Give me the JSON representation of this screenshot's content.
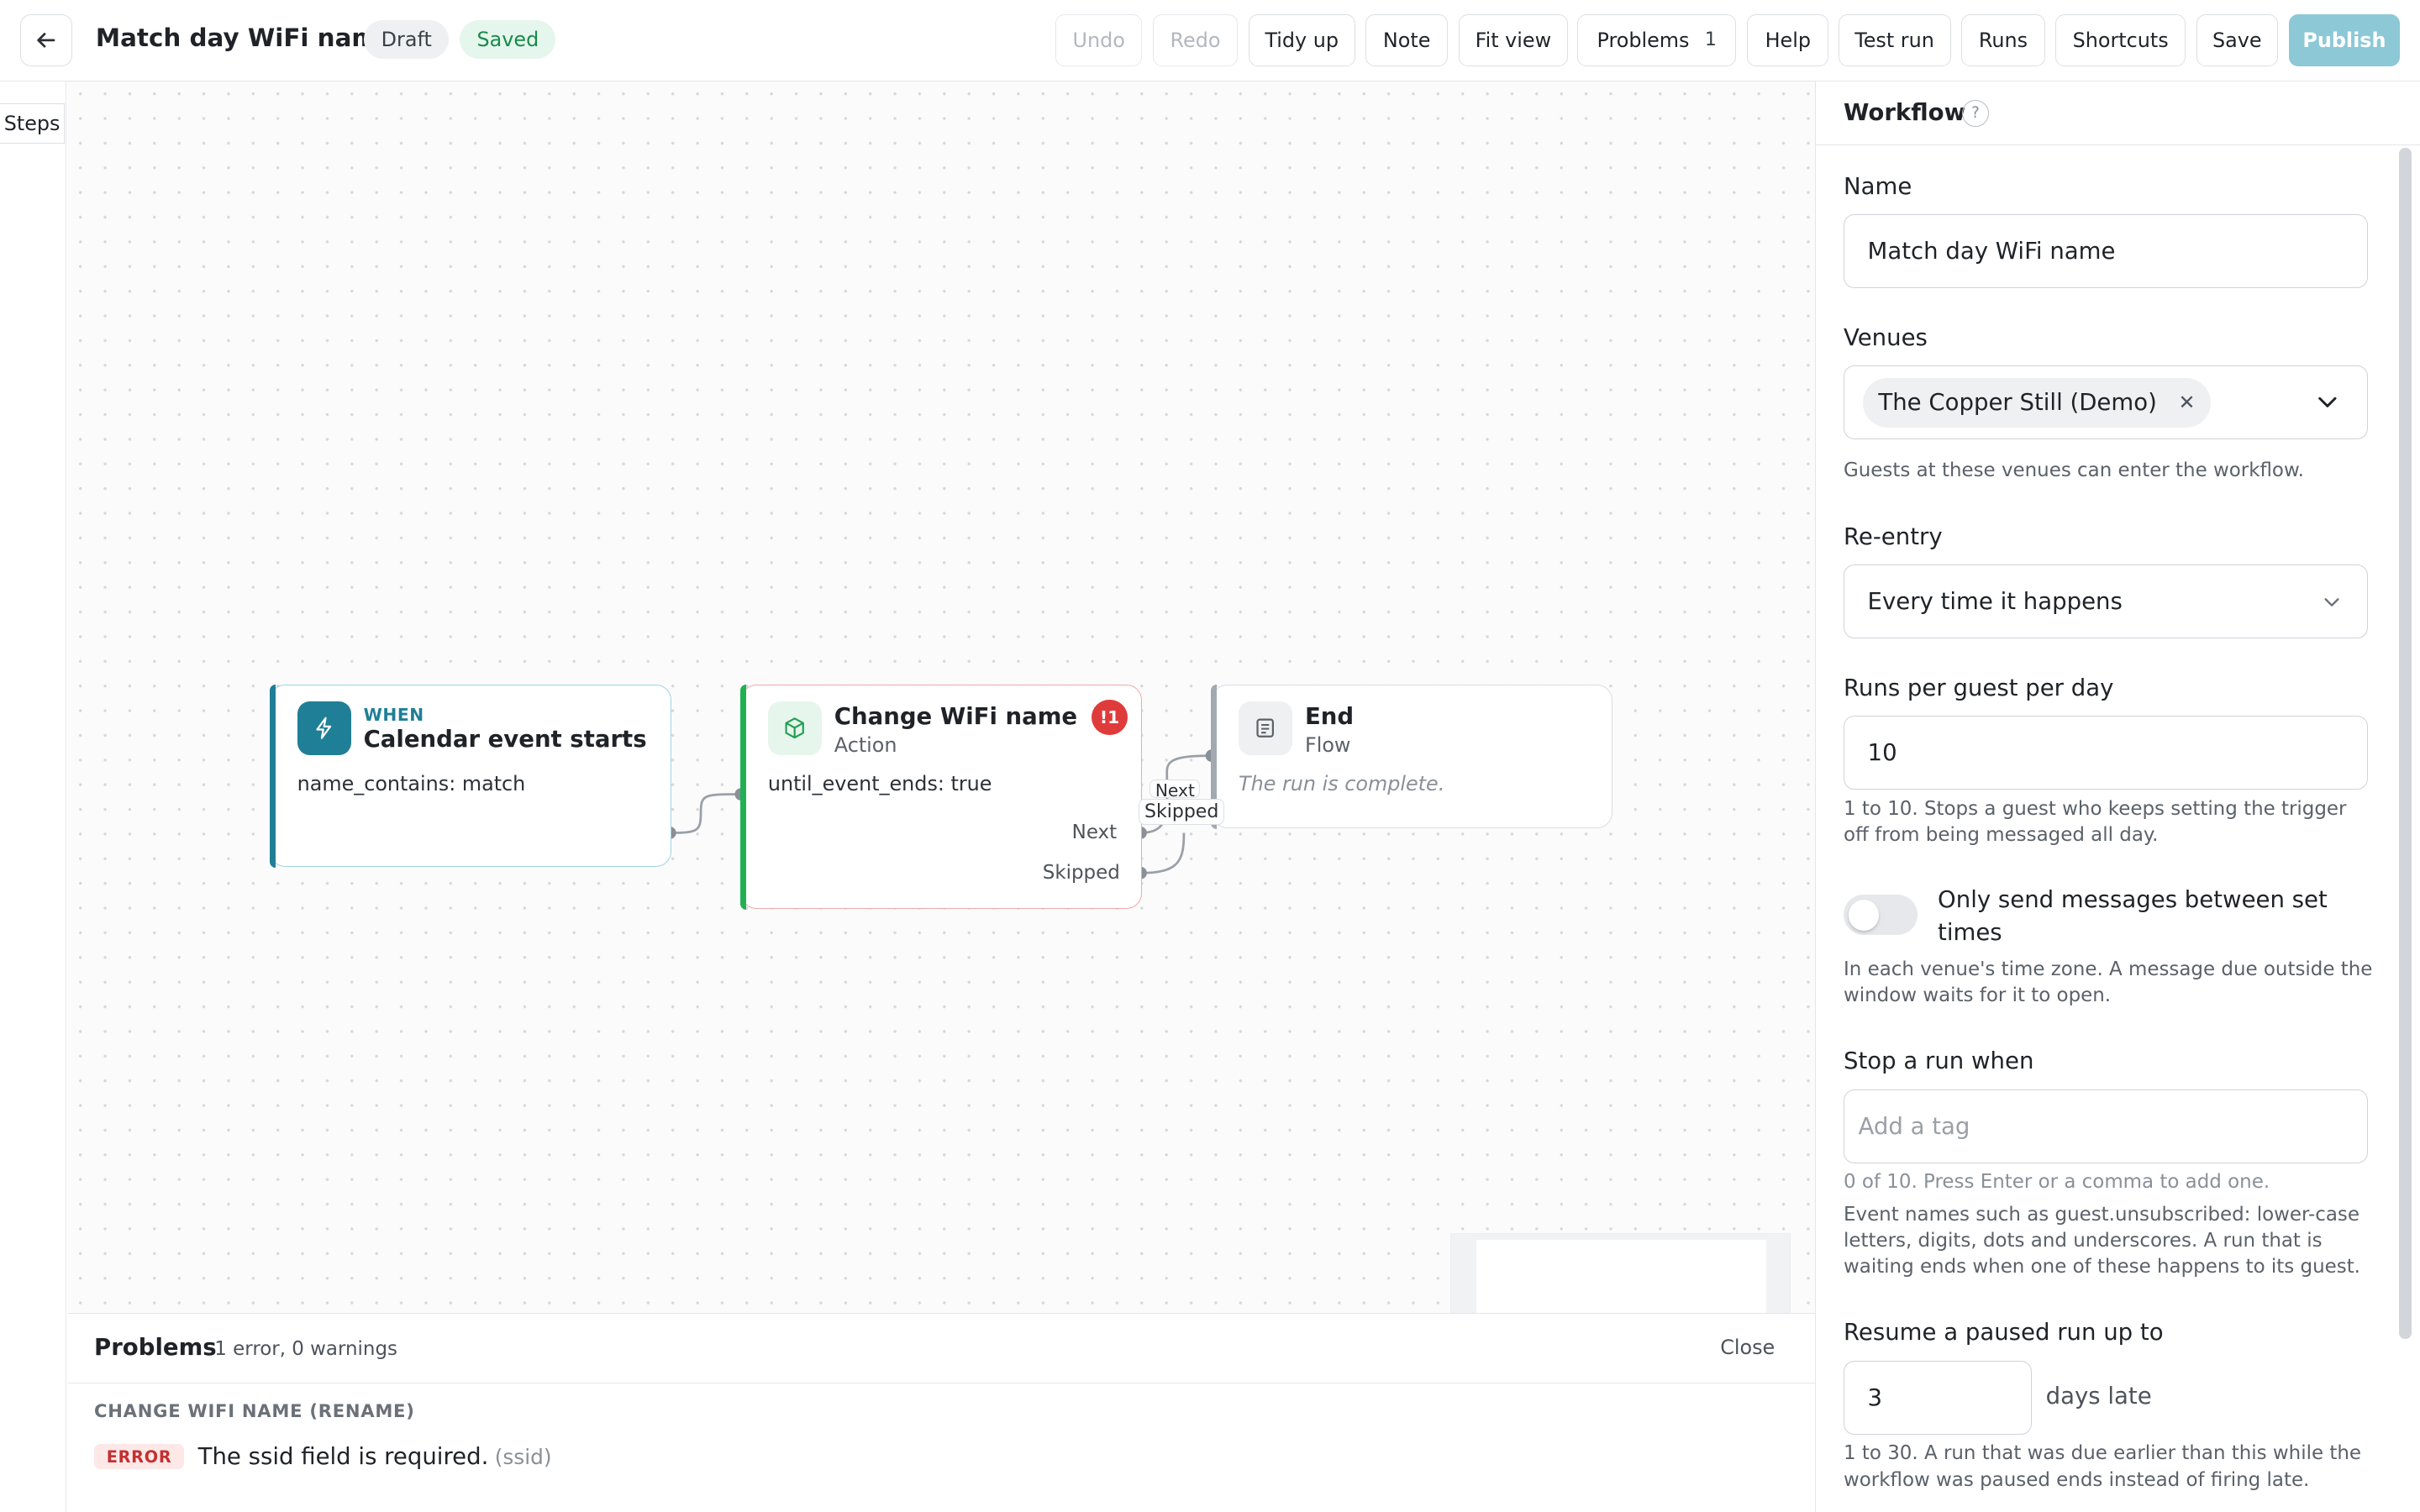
{
  "header": {
    "title": "Match day WiFi name",
    "status_draft": "Draft",
    "status_saved": "Saved",
    "buttons": {
      "undo": "Undo",
      "redo": "Redo",
      "tidy_up": "Tidy up",
      "note": "Note",
      "fit_view": "Fit view",
      "problems": "Problems",
      "problems_count": "1",
      "help": "Help",
      "test_run": "Test run",
      "runs": "Runs",
      "shortcuts": "Shortcuts",
      "save": "Save",
      "publish": "Publish"
    }
  },
  "sidebar": {
    "steps_tab": "Steps"
  },
  "canvas": {
    "nodes": {
      "trigger": {
        "kicker": "WHEN",
        "title": "Calendar event starts",
        "body": "name_contains: match"
      },
      "action": {
        "title": "Change WiFi name",
        "subtitle": "Action",
        "body": "until_event_ends: true",
        "error_badge": "!1",
        "port_next": "Next",
        "port_skipped": "Skipped"
      },
      "end": {
        "title": "End",
        "subtitle": "Flow",
        "body": "The run is complete."
      }
    },
    "edge_labels": {
      "next": "Next",
      "skipped": "Skipped"
    }
  },
  "problems_panel": {
    "title": "Problems",
    "summary": "1 error, 0 warnings",
    "close": "Close",
    "group": "CHANGE WIFI NAME (RENAME)",
    "items": [
      {
        "severity": "ERROR",
        "message": "The ssid field is required.",
        "field": "(ssid)"
      }
    ]
  },
  "inspector": {
    "title": "Workflow",
    "help_icon": "?",
    "name": {
      "label": "Name",
      "value": "Match day WiFi name"
    },
    "venues": {
      "label": "Venues",
      "chip": "The Copper Still (Demo)",
      "help": "Guests at these venues can enter the workflow."
    },
    "reentry": {
      "label": "Re-entry",
      "value": "Every time it happens"
    },
    "runs_per_day": {
      "label": "Runs per guest per day",
      "value": "10",
      "help": "1 to 10. Stops a guest who keeps setting the trigger off from being messaged all day."
    },
    "send_window": {
      "label": "Only send messages between set times",
      "enabled": false,
      "help": "In each venue's time zone. A message due outside the window waits for it to open."
    },
    "stop_run": {
      "label": "Stop a run when",
      "placeholder": "Add a tag",
      "count_help": "0 of 10. Press Enter or a comma to add one.",
      "help": "Event names such as guest.unsubscribed: lower-case letters, digits, dots and underscores. A run that is waiting ends when one of these happens to its guest."
    },
    "resume": {
      "label": "Resume a paused run up to",
      "value": "3",
      "suffix": "days late",
      "help": "1 to 30. A run that was due earlier than this while the workflow was paused ends instead of firing late."
    }
  },
  "colors": {
    "accent": "#1f7f96",
    "success": "#22b055",
    "error": "#e03b3b",
    "publish": "#8cc8d6"
  },
  "icons": {
    "back": "arrow-left-icon",
    "trigger": "bolt-icon",
    "action": "cube-icon",
    "end": "document-icon",
    "chevron": "chevron-down-icon",
    "remove": "close-icon"
  }
}
